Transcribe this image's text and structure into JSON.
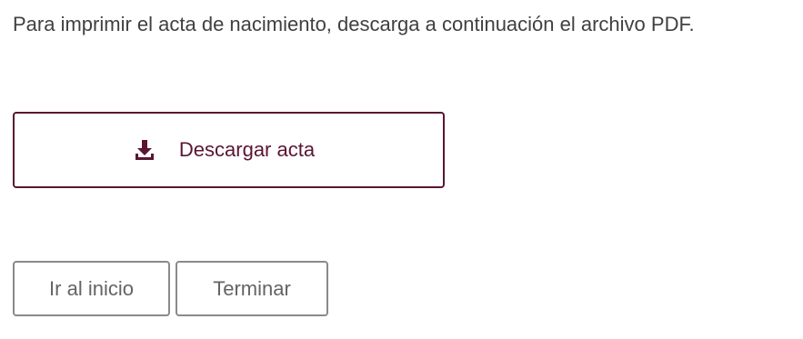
{
  "instruction": {
    "text": "Para imprimir el acta de nacimiento, descarga a continuación el archivo PDF."
  },
  "download": {
    "label": "Descargar acta",
    "icon": "download-icon",
    "color": "#5a1532"
  },
  "navigation": {
    "home_label": "Ir al inicio",
    "finish_label": "Terminar"
  }
}
